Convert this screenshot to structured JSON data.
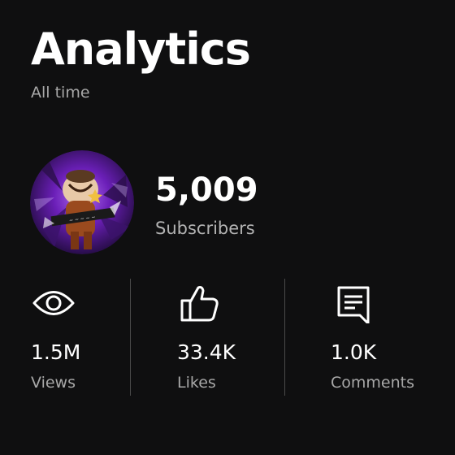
{
  "header": {
    "title": "Analytics",
    "subtitle": "All time"
  },
  "channel": {
    "subscribers_count": "5,009",
    "subscribers_label": "Subscribers"
  },
  "stats": [
    {
      "value": "1.5M",
      "label": "Views",
      "icon": "eye-icon"
    },
    {
      "value": "33.4K",
      "label": "Likes",
      "icon": "thumbs-up-icon"
    },
    {
      "value": "1.0K",
      "label": "Comments",
      "icon": "comment-icon"
    }
  ],
  "colors": {
    "background": "#0f0f10",
    "primary_text": "#ffffff",
    "secondary_text": "#a8a8a8",
    "divider": "#4a4a4a",
    "avatar_accent": "#7b2fd0"
  }
}
